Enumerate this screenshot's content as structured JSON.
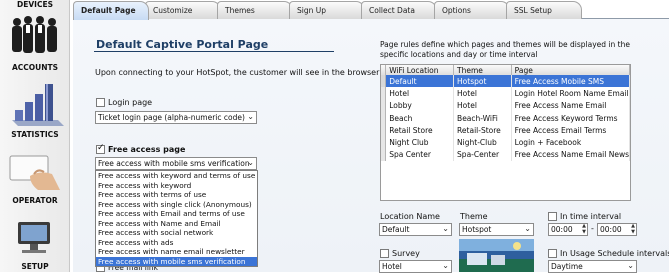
{
  "sidebar": {
    "items": [
      {
        "label": "DEVICES",
        "icon": "devices-icon"
      },
      {
        "label": "ACCOUNTS",
        "icon": "accounts-people-icon"
      },
      {
        "label": "STATISTICS",
        "icon": "statistics-bar-icon"
      },
      {
        "label": "OPERATOR",
        "icon": "operator-card-icon"
      },
      {
        "label": "SETUP",
        "icon": "setup-gear-icon"
      }
    ]
  },
  "tabs": [
    {
      "label": "Default Page",
      "active": true
    },
    {
      "label": "Customize"
    },
    {
      "label": "Themes"
    },
    {
      "label": "Sign Up"
    },
    {
      "label": "Collect Data"
    },
    {
      "label": "Options"
    },
    {
      "label": "SSL Setup"
    }
  ],
  "main": {
    "title": "Default Captive Portal Page",
    "intro": "Upon connecting to your HotSpot, the customer will see in the browser:",
    "login_page": {
      "label": "Login page",
      "checked": false,
      "select_value": "Ticket login page (alpha-numeric code)"
    },
    "free_access": {
      "label": "Free access page",
      "checked": true,
      "select_value": "Free access with mobile sms verification",
      "options": [
        "Free access with keyword and terms of use",
        "Free access with keyword",
        "Free access with terms of use",
        "Free access with single click (Anonymous)",
        "Free access with Email and terms of use",
        "Free access with Name and Email",
        "Free access with social network",
        "Free access with ads",
        "Free access with name email newsletter",
        "Free access with mobile sms verification"
      ],
      "selected_index": 9
    },
    "hidden_partial_label": "Free mail link"
  },
  "rules": {
    "description": "Page rules define which pages and themes will be displayed in the specific locations and day or time interval",
    "columns": [
      "WiFi Location",
      "Theme",
      "Page"
    ],
    "rows": [
      [
        "Default",
        "Hotspot",
        "Free Access Mobile SMS"
      ],
      [
        "Hotel",
        "Hotel",
        "Login Hotel Room Name Email"
      ],
      [
        "Lobby",
        "Hotel",
        "Free Access Name Email"
      ],
      [
        "Beach",
        "Beach-WiFi",
        "Free Access Keyword Terms"
      ],
      [
        "Retail Store",
        "Retail-Store",
        "Free Access Email Terms"
      ],
      [
        "Night Club",
        "Night-Club",
        "Login + Facebook"
      ],
      [
        "Spa Center",
        "Spa-Center",
        "Free Access Name Email News"
      ]
    ],
    "selected_row": 0
  },
  "rule_editor": {
    "location_label": "Location Name",
    "location_value": "Default",
    "theme_label": "Theme",
    "theme_value": "Hotspot",
    "time_interval_label": "In time interval",
    "time_from": "00:00",
    "time_sep": "-",
    "time_to": "00:00",
    "survey_label": "Survey",
    "survey_value": "Hotel",
    "schedule_label": "In Usage Schedule intervals",
    "schedule_value": "Daytime"
  },
  "colors": {
    "accent": "#3b74d6",
    "title": "#1f3f66"
  }
}
